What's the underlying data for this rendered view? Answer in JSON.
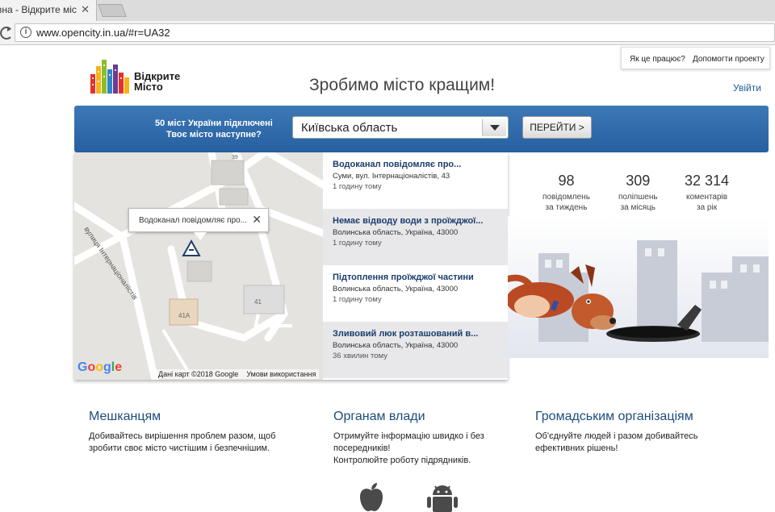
{
  "browser": {
    "tab_title": "вна - Відкрите міс",
    "tab_close": "✕",
    "url": "www.opencity.in.ua/#r=UA32",
    "info_icon": "i"
  },
  "header": {
    "help_how": "Як це працює?",
    "help_project": "Допомогти проекту",
    "logo_line1": "Відкрите",
    "logo_line2": "Місто",
    "slogan": "Зробимо місто кращим!",
    "login": "Увійти"
  },
  "bluebar": {
    "line1": "50 міст України підключені",
    "line2": "Твоє місто наступне?",
    "region": "Київська область",
    "go_button": "ПЕРЕЙТИ >"
  },
  "map": {
    "popup_text": "Водоканал повідомляє про...",
    "popup_close": "✕",
    "street_label": "вулиця Інтернаціоналістів",
    "num_39": "39",
    "num_41": "41",
    "num_41a": "41А",
    "footer_data": "Дані карт ©2018 Google",
    "footer_terms": "Умови використання",
    "google": "Google"
  },
  "feed": [
    {
      "title": "Водоканал повідомляє про...",
      "location": "Суми, вул. Інтернаціоналістів, 43",
      "time": "1 годину тому"
    },
    {
      "title": "Немає відводу води з проїжджої...",
      "location": "Волинська область, Україна, 43000",
      "time": "1 годину тому"
    },
    {
      "title": "Підтоплення проїжджої частини",
      "location": "Волинська область, Україна, 43000",
      "time": "1 годину тому"
    },
    {
      "title": "Зливовий люк розташований в...",
      "location": "Волинська область, Україна, 43000",
      "time": "36 хвилин тому"
    }
  ],
  "stats": [
    {
      "num": "98",
      "l1": "повідомлень",
      "l2": "за тиждень"
    },
    {
      "num": "309",
      "l1": "поліпшень",
      "l2": "за місяць"
    },
    {
      "num": "32 314",
      "l1": "коментарів",
      "l2": "за рік"
    }
  ],
  "columns": [
    {
      "title": "Мешканцям",
      "l1": "Добивайтесь вирішення проблем разом, щоб",
      "l2": "зробити своє місто чистішим і безпечнішим.",
      "l3": ""
    },
    {
      "title": "Органам влади",
      "l1": "Отримуйте інформацію швидко і без",
      "l2": "посередників!",
      "l3": "Контролюйте роботу підрядників."
    },
    {
      "title": "Громадським організаціям",
      "l1": "Об'єднуйте людей і разом добивайтесь",
      "l2": "ефективних рішень!",
      "l3": ""
    }
  ],
  "colors": {
    "accent": "#2d68a8",
    "link": "#1e5a96"
  }
}
